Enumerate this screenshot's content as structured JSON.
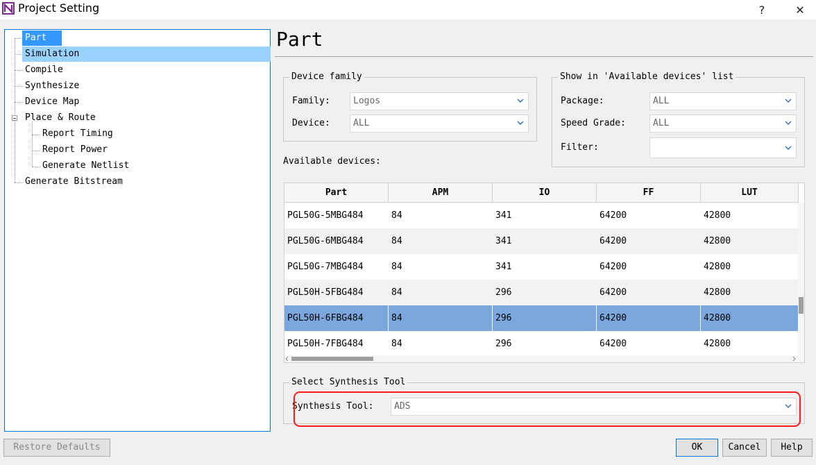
{
  "window": {
    "title": "Project Setting",
    "help_glyph": "?",
    "close_glyph": "✕"
  },
  "tree": {
    "items": [
      {
        "label": "Part"
      },
      {
        "label": "Simulation"
      },
      {
        "label": "Compile"
      },
      {
        "label": "Synthesize"
      },
      {
        "label": "Device Map"
      },
      {
        "label": "Place & Route"
      },
      {
        "label": "Report Timing"
      },
      {
        "label": "Report Power"
      },
      {
        "label": "Generate Netlist"
      },
      {
        "label": "Generate Bitstream"
      }
    ]
  },
  "page": {
    "title": "Part"
  },
  "device_family": {
    "legend": "Device family",
    "family_label": "Family:",
    "family_value": "Logos",
    "device_label": "Device:",
    "device_value": "ALL"
  },
  "show_list": {
    "legend": "Show in 'Available devices' list",
    "package_label": "Package:",
    "package_value": "ALL",
    "speed_label": "Speed Grade:",
    "speed_value": "ALL",
    "filter_label": "Filter:",
    "filter_value": ""
  },
  "devices": {
    "label": "Available devices:",
    "columns": [
      "Part",
      "APM",
      "IO",
      "FF",
      "LUT"
    ],
    "rows": [
      [
        "PGL50G-5MBG484",
        "84",
        "341",
        "64200",
        "42800"
      ],
      [
        "PGL50G-6MBG484",
        "84",
        "341",
        "64200",
        "42800"
      ],
      [
        "PGL50G-7MBG484",
        "84",
        "341",
        "64200",
        "42800"
      ],
      [
        "PGL50H-5FBG484",
        "84",
        "296",
        "64200",
        "42800"
      ],
      [
        "PGL50H-6FBG484",
        "84",
        "296",
        "64200",
        "42800"
      ],
      [
        "PGL50H-7FBG484",
        "84",
        "296",
        "64200",
        "42800"
      ]
    ],
    "selected_index": 4
  },
  "synthesis": {
    "legend": "Select Synthesis Tool",
    "tool_label": "Synthesis Tool:",
    "tool_value": "ADS"
  },
  "buttons": {
    "restore": "Restore Defaults",
    "ok": "OK",
    "cancel": "Cancel",
    "help": "Help"
  },
  "colors": {
    "selection": "#3399ff",
    "row_selected": "#7aa7dd",
    "highlight": "#ff1a1a",
    "accent": "#0078d7"
  }
}
